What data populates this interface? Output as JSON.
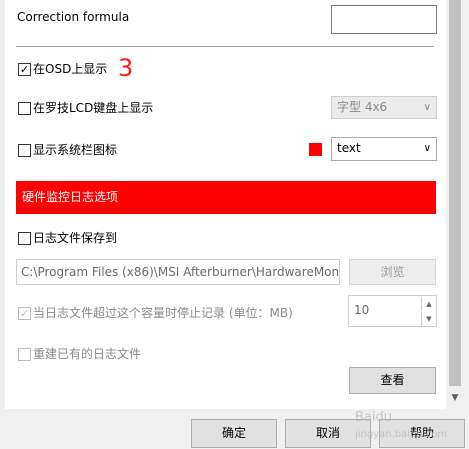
{
  "correction_formula": {
    "label": "Correction formula",
    "value": ""
  },
  "osd": {
    "label": "在OSD上显示",
    "checked": true,
    "annotation": "3"
  },
  "lcd": {
    "label": "在罗技LCD键盘上显示",
    "checked": false,
    "font_value": "字型 4x6"
  },
  "tray": {
    "label": "显示系统栏图标",
    "checked": false,
    "color": "#ff0000",
    "mode_value": "text"
  },
  "section_header": {
    "label": "硬件监控日志选项",
    "color": "#ff0000"
  },
  "log": {
    "save_label": "日志文件保存到",
    "save_checked": false,
    "path_value": "C:\\Program Files (x86)\\MSI Afterburner\\HardwareMon",
    "browse_label": "浏览",
    "limit_label": "当日志文件超过这个容量时停止记录 (单位：MB)",
    "limit_checked": true,
    "limit_value": "10",
    "recreate_label": "重建已有的日志文件",
    "recreate_checked": false,
    "view_label": "查看"
  },
  "footer": {
    "ok_label": "确定",
    "cancel_label": "取消",
    "help_label": "帮助"
  },
  "watermark": {
    "line1": "Baidu",
    "line2": "jingyan.baidu.com"
  }
}
